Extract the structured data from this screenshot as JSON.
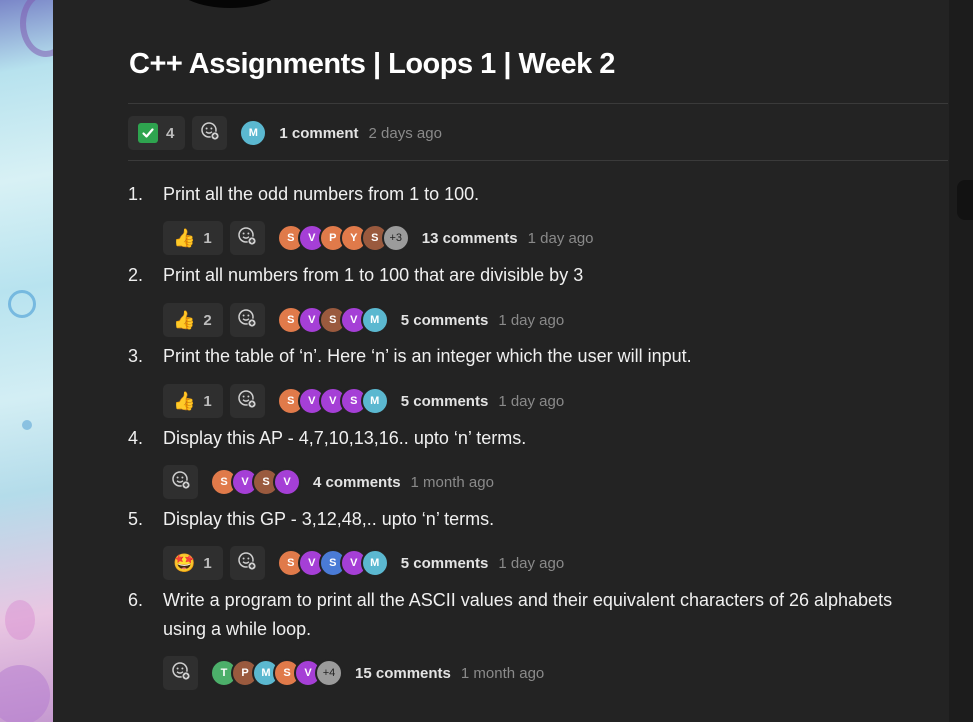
{
  "page": {
    "title": "C++ Assignments | Loops 1 | Week 2"
  },
  "header_meta": {
    "reaction": {
      "icon": "check-mark-icon",
      "count": "4"
    },
    "avatar": {
      "letter": "M",
      "color": "#5bb8d0"
    },
    "comments": "1 comment",
    "time": "2 days ago"
  },
  "items": [
    {
      "number": "1.",
      "text": "Print all the odd numbers from 1 to 100.",
      "reaction": {
        "emoji": "👍",
        "icon": "thumbs-up-icon",
        "count": "1"
      },
      "avatars": [
        {
          "letter": "S",
          "color": "#e07a4a"
        },
        {
          "letter": "V",
          "color": "#a53fd6"
        },
        {
          "letter": "P",
          "color": "#e07a4a"
        },
        {
          "letter": "Y",
          "color": "#e07a4a"
        },
        {
          "letter": "S",
          "color": "#9a5a3e"
        },
        {
          "letter": "+3",
          "more": true
        }
      ],
      "comments": "13 comments",
      "time": "1 day ago"
    },
    {
      "number": "2.",
      "text": "Print all numbers from 1 to 100 that are divisible by 3",
      "reaction": {
        "emoji": "👍",
        "icon": "thumbs-up-icon",
        "count": "2"
      },
      "avatars": [
        {
          "letter": "S",
          "color": "#e07a4a"
        },
        {
          "letter": "V",
          "color": "#a53fd6"
        },
        {
          "letter": "S",
          "color": "#9a5a3e"
        },
        {
          "letter": "V",
          "color": "#a53fd6"
        },
        {
          "letter": "M",
          "color": "#5bb8d0"
        }
      ],
      "comments": "5 comments",
      "time": "1 day ago"
    },
    {
      "number": "3.",
      "text": "Print the table of ‘n’. Here ‘n’ is an integer which the user will input.",
      "reaction": {
        "emoji": "👍",
        "icon": "thumbs-up-icon",
        "count": "1"
      },
      "avatars": [
        {
          "letter": "S",
          "color": "#e07a4a"
        },
        {
          "letter": "V",
          "color": "#a53fd6"
        },
        {
          "letter": "V",
          "color": "#a53fd6"
        },
        {
          "letter": "S",
          "color": "#a53fd6"
        },
        {
          "letter": "M",
          "color": "#5bb8d0"
        }
      ],
      "comments": "5 comments",
      "time": "1 day ago"
    },
    {
      "number": "4.",
      "text": "Display this AP - 4,7,10,13,16.. upto ‘n’ terms.",
      "reaction": null,
      "avatars": [
        {
          "letter": "S",
          "color": "#e07a4a"
        },
        {
          "letter": "V",
          "color": "#a53fd6"
        },
        {
          "letter": "S",
          "color": "#9a5a3e"
        },
        {
          "letter": "V",
          "color": "#a53fd6"
        }
      ],
      "comments": "4 comments",
      "time": "1 month ago"
    },
    {
      "number": "5.",
      "text": "Display this GP - 3,12,48,.. upto ‘n’ terms.",
      "reaction": {
        "emoji": "🤩",
        "icon": "star-struck-icon",
        "count": "1"
      },
      "avatars": [
        {
          "letter": "S",
          "color": "#e07a4a"
        },
        {
          "letter": "V",
          "color": "#a53fd6"
        },
        {
          "letter": "S",
          "color": "#4a7bd6"
        },
        {
          "letter": "V",
          "color": "#a53fd6"
        },
        {
          "letter": "M",
          "color": "#5bb8d0"
        }
      ],
      "comments": "5 comments",
      "time": "1 day ago"
    },
    {
      "number": "6.",
      "text": "Write a program to print all the ASCII values and their equivalent characters of 26 alphabets using a while loop.",
      "reaction": null,
      "avatars": [
        {
          "letter": "T",
          "color": "#4caf6a"
        },
        {
          "letter": "P",
          "color": "#9a5a3e"
        },
        {
          "letter": "M",
          "color": "#5bb8d0"
        },
        {
          "letter": "S",
          "color": "#e07a4a"
        },
        {
          "letter": "V",
          "color": "#a53fd6"
        },
        {
          "letter": "+4",
          "more": true
        }
      ],
      "comments": "15 comments",
      "time": "1 month ago"
    }
  ]
}
